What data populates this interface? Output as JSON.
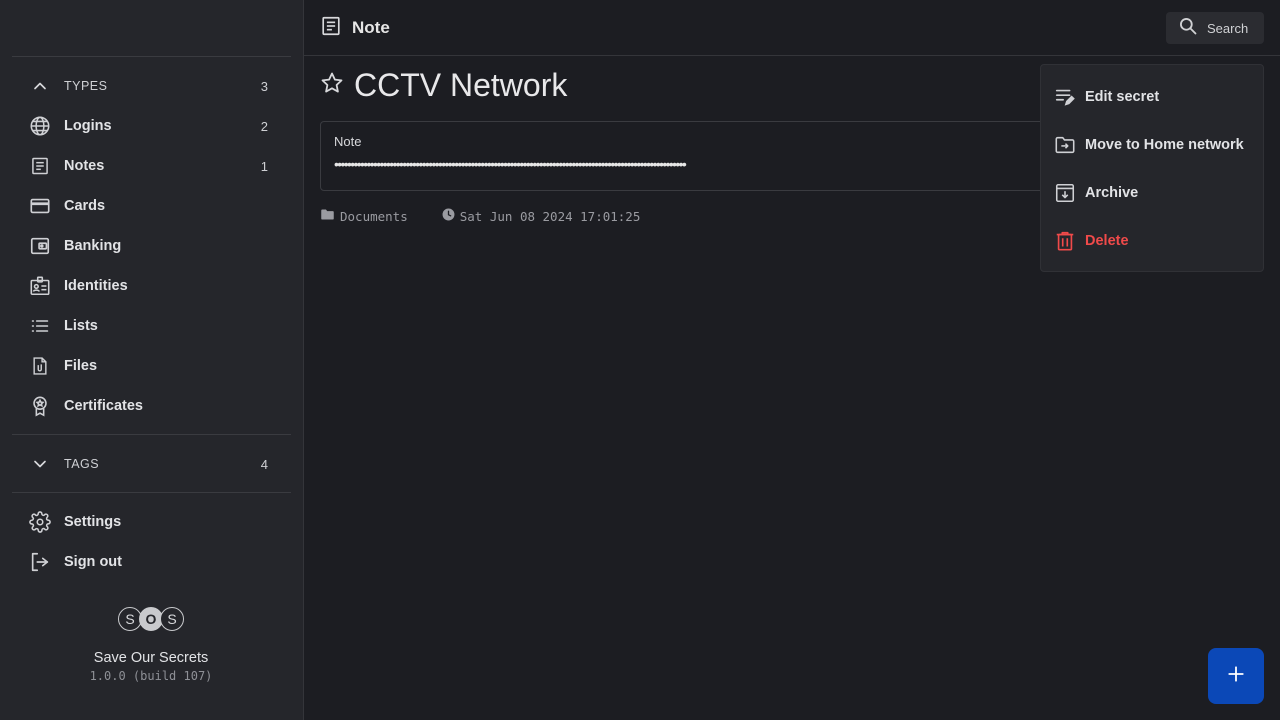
{
  "sidebar": {
    "types": {
      "label": "TYPES",
      "count": "3"
    },
    "items": [
      {
        "label": "Logins",
        "count": "2",
        "icon": "globe-icon"
      },
      {
        "label": "Notes",
        "count": "1",
        "icon": "note-icon"
      },
      {
        "label": "Cards",
        "count": "",
        "icon": "credit-card-icon"
      },
      {
        "label": "Banking",
        "count": "",
        "icon": "wallet-icon"
      },
      {
        "label": "Identities",
        "count": "",
        "icon": "id-badge-icon"
      },
      {
        "label": "Lists",
        "count": "",
        "icon": "list-icon"
      },
      {
        "label": "Files",
        "count": "",
        "icon": "file-attachment-icon"
      },
      {
        "label": "Certificates",
        "count": "",
        "icon": "certificate-icon"
      }
    ],
    "tags": {
      "label": "TAGS",
      "count": "4"
    },
    "settings_label": "Settings",
    "signout_label": "Sign out"
  },
  "brand": {
    "logo_letters": [
      "S",
      "O",
      "S"
    ],
    "name": "Save Our Secrets",
    "version": "1.0.0 (build 107)"
  },
  "header": {
    "title": "Note",
    "search_label": "Search"
  },
  "secret": {
    "title": "CCTV Network",
    "field_label": "Note",
    "field_value": "••••••••••••••••••••••••••••••••••••••••••••••••••••••••••••••••••••••••••••••••••••••••••••••••••••••••••••",
    "folder": "Documents",
    "timestamp": "Sat Jun 08 2024 17:01:25"
  },
  "menu": {
    "edit_label": "Edit secret",
    "move_label": "Move to Home network",
    "archive_label": "Archive",
    "delete_label": "Delete"
  },
  "colors": {
    "background": "#1c1d22",
    "sidebar": "#25262b",
    "danger": "#f04a4a",
    "fab": "#0b48b7"
  }
}
